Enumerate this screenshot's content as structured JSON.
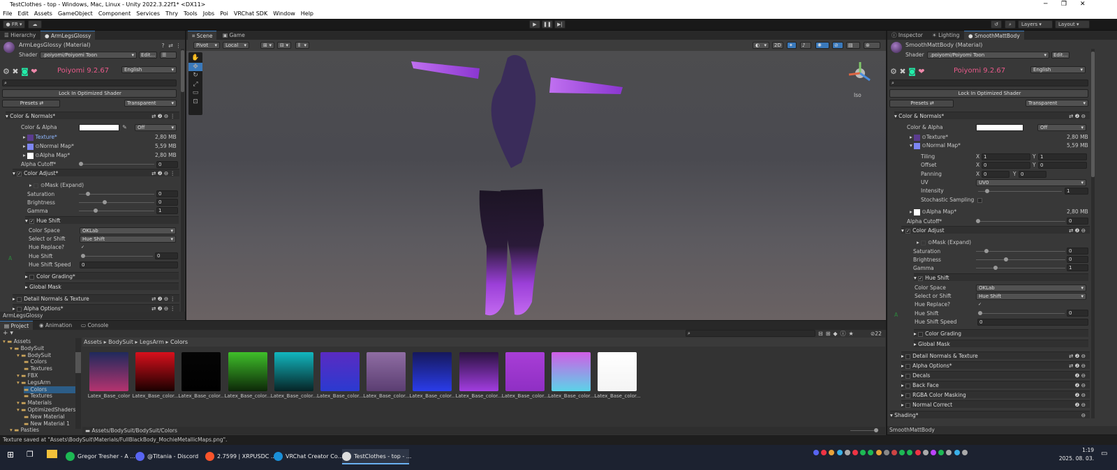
{
  "window": {
    "title": "TestClothes - top - Windows, Mac, Linux - Unity 2022.3.22f1* <DX11>"
  },
  "menu": [
    "File",
    "Edit",
    "Assets",
    "GameObject",
    "Component",
    "Services",
    "Thry",
    "Tools",
    "Jobs",
    "Poi",
    "VRChat SDK",
    "Window",
    "Help"
  ],
  "toolbar": {
    "account": "FR",
    "layers": "Layers",
    "layout": "Layout"
  },
  "left": {
    "tabs": [
      "Hierarchy",
      "ArmLegsGlossy"
    ],
    "material_name": "ArmLegsGlossy (Material)",
    "shader_label": "Shader",
    "shader_value": ".poiyomi/Poiyomi Toon",
    "edit": "Edit...",
    "poiyomi": "Poiyomi 9.2.67",
    "language": "English",
    "lock": "Lock In Optimized Shader",
    "presets": "Presets",
    "render_mode": "Transparent",
    "color_normals": "Color & Normals*",
    "color_alpha": "Color & Alpha",
    "off": "Off",
    "texture": "Texture*",
    "texture_size": "2,80 MB",
    "normal": "Normal Map*",
    "normal_size": "5,59 MB",
    "alpha": "Alpha Map*",
    "alpha_size": "2,80 MB",
    "alpha_cutoff": "Alpha Cutoff*",
    "alpha_cutoff_val": "0",
    "color_adjust": "Color Adjust*",
    "mask": "Mask (Expand)",
    "saturation": "Saturation",
    "saturation_val": "0",
    "brightness": "Brightness",
    "brightness_val": "0",
    "gamma": "Gamma",
    "gamma_val": "1",
    "hue_shift": "Hue Shift",
    "color_space": "Color Space",
    "color_space_val": "OKLab",
    "select_shift": "Select or Shift",
    "select_shift_val": "Hue Shift",
    "hue_replace": "Hue Replace?",
    "hue_shift_lbl": "Hue Shift",
    "hue_shift_val": "0",
    "hue_shift_speed": "Hue Shift Speed",
    "hue_shift_speed_val": "0",
    "color_grading": "Color Grading*",
    "global_mask": "Global Mask",
    "detail_normals": "Detail Normals & Texture",
    "alpha_options": "Alpha Options*",
    "footer": "ArmLegsGlossy",
    "side_marker": "A"
  },
  "scene": {
    "tabs": [
      "Scene",
      "Game"
    ],
    "pivot": "Pivot",
    "local": "Local",
    "twod": "2D",
    "iso": "Iso"
  },
  "right": {
    "tabs": [
      "Inspector",
      "Lighting",
      "SmoothMattBody"
    ],
    "material_name": "SmoothMattBody (Material)",
    "shader_label": "Shader",
    "shader_value": ".poiyomi/Poiyomi Toon",
    "edit": "Edit...",
    "poiyomi": "Poiyomi 9.2.67",
    "language": "English",
    "lock": "Lock In Optimized Shader",
    "presets": "Presets",
    "render_mode": "Transparent",
    "color_normals": "Color & Normals*",
    "color_alpha": "Color & Alpha",
    "off": "Off",
    "texture": "Texture*",
    "texture_size": "2,80 MB",
    "normal": "Normal Map*",
    "normal_size": "5,59 MB",
    "tiling": "Tiling",
    "tiling_x": "1",
    "tiling_y": "1",
    "offset": "Offset",
    "offset_x": "0",
    "offset_y": "0",
    "panning": "Panning",
    "panning_x": "0",
    "panning_y": "0",
    "uv": "UV",
    "uv_val": "UV0",
    "intensity": "Intensity",
    "intensity_val": "1",
    "stochastic": "Stochastic Sampling",
    "alpha": "Alpha Map*",
    "alpha_size": "2,80 MB",
    "alpha_cutoff": "Alpha Cutoff*",
    "alpha_cutoff_val": "0",
    "color_adjust": "Color Adjust",
    "mask": "Mask (Expand)",
    "saturation": "Saturation",
    "saturation_val": "0",
    "brightness": "Brightness",
    "brightness_val": "0",
    "gamma": "Gamma",
    "gamma_val": "1",
    "hue_shift": "Hue Shift",
    "color_space": "Color Space",
    "color_space_val": "OKLab",
    "select_shift": "Select or Shift",
    "select_shift_val": "Hue Shift",
    "hue_replace": "Hue Replace?",
    "hue_shift_lbl": "Hue Shift",
    "hue_shift_val": "0",
    "hue_shift_speed": "Hue Shift Speed",
    "hue_shift_speed_val": "0",
    "color_grading": "Color Grading",
    "global_mask": "Global Mask",
    "detail_normals": "Detail Normals & Texture",
    "alpha_options": "Alpha Options*",
    "decals": "Decals",
    "back_face": "Back Face",
    "rgba": "RGBA Color Masking",
    "normal_correct": "Normal Correct",
    "shading": "Shading*",
    "footer": "SmoothMattBody",
    "side_marker": "A"
  },
  "project": {
    "tabs": [
      "Project",
      "Animation",
      "Console"
    ],
    "breadcrumb": [
      "Assets",
      "BodySuit",
      "LegsArm",
      "Colors"
    ],
    "tree": [
      {
        "label": "Assets",
        "indent": 0
      },
      {
        "label": "BodySuit",
        "indent": 1
      },
      {
        "label": "BodySuit",
        "indent": 2
      },
      {
        "label": "Colors",
        "indent": 3
      },
      {
        "label": "Textures",
        "indent": 3
      },
      {
        "label": "FBX",
        "indent": 2
      },
      {
        "label": "LegsArm",
        "indent": 2
      },
      {
        "label": "Colors",
        "indent": 3
      },
      {
        "label": "Textures",
        "indent": 3
      },
      {
        "label": "Materials",
        "indent": 2
      },
      {
        "label": "OptimizedShaders",
        "indent": 2
      },
      {
        "label": "New Material",
        "indent": 3
      },
      {
        "label": "New Material 1",
        "indent": 3
      },
      {
        "label": "Pasties",
        "indent": 1
      }
    ],
    "items": [
      {
        "label": "Latex_Base_color",
        "top": "#1f2a5c",
        "bottom": "#b5336f"
      },
      {
        "label": "Latex_Base_color...",
        "top": "#d8101c",
        "bottom": "#1a0000"
      },
      {
        "label": "Latex_Base_color...",
        "top": "#050505",
        "bottom": "#000000"
      },
      {
        "label": "Latex_Base_color...",
        "top": "#3fbf2a",
        "bottom": "#0d2808"
      },
      {
        "label": "Latex_Base_color...",
        "top": "#12b7bf",
        "bottom": "#062426"
      },
      {
        "label": "Latex_Base_color...",
        "top": "#5a2bc2",
        "bottom": "#2b3ad0"
      },
      {
        "label": "Latex_Base_color...",
        "top": "#8f6da3",
        "bottom": "#5b3e72"
      },
      {
        "label": "Latex_Base_color...",
        "top": "#15185c",
        "bottom": "#2a3cea"
      },
      {
        "label": "Latex_Base_color...",
        "top": "#2a1240",
        "bottom": "#a23de0"
      },
      {
        "label": "Latex_Base_color...",
        "top": "#a83ed6",
        "bottom": "#8f2fc4"
      },
      {
        "label": "Latex_Base_color...",
        "top": "#d05ee6",
        "bottom": "#5bd4e8"
      },
      {
        "label": "Latex_Base_color...",
        "top": "#ffffff",
        "bottom": "#f4f4f4"
      }
    ],
    "path": "Assets/BodySuit/BodySuit/Colors",
    "count": "22"
  },
  "status": "Texture saved at \"Assets\\BodySuit\\Materials/FullBlackBody_MochieMetallicMaps.png\".",
  "taskbar": {
    "apps": [
      {
        "label": "Gregor Tresher - A ...",
        "color": "#1db954"
      },
      {
        "label": "@Titania - Discord",
        "color": "#5865f2"
      },
      {
        "label": "2.7599 | XRPUSDC ...",
        "color": "#fb542b"
      },
      {
        "label": "VRChat Creator Co...",
        "color": "#1a8fd8"
      },
      {
        "label": "TestClothes - top - ...",
        "color": "#dddddd"
      }
    ],
    "time": "1:19",
    "date": "2025. 08. 03."
  }
}
